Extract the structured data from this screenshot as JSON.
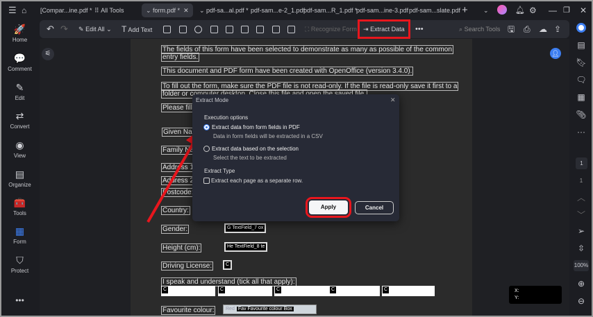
{
  "tabs": {
    "compare": "[Compar...ine.pdf *",
    "all_tools": "All Tools",
    "form": "form.pdf *",
    "t1": "pdf-sa...al.pdf *",
    "t2": "pdf-sam...e-2_1.pdf",
    "t3": "pdf-sam...R_1.pdf *",
    "t4": "pdf-sam...ine-3.pdf",
    "t5": "pdf-sam...slate.pdf"
  },
  "toolbar": {
    "edit_all": "Edit All",
    "add_text": "Add Text",
    "recognize_form": "Recognize Form",
    "extract_data": "Extract Data",
    "search_tools": "Search Tools"
  },
  "sidebar": {
    "items": [
      {
        "label": "Home",
        "icon": "🚀"
      },
      {
        "label": "Comment",
        "icon": "💬"
      },
      {
        "label": "Edit",
        "icon": "✎"
      },
      {
        "label": "Convert",
        "icon": "⇄"
      },
      {
        "label": "View",
        "icon": "◉"
      },
      {
        "label": "Organize",
        "icon": "▤"
      },
      {
        "label": "Tools",
        "icon": "🧰"
      },
      {
        "label": "Form",
        "icon": "▦"
      },
      {
        "label": "Protect",
        "icon": "⛉"
      }
    ]
  },
  "pdf": {
    "p1": "The fields of this form have been selected to demonstrate as many as possible of the common",
    "p1b": "entry fields.",
    "p2": "This document and PDF form have been created with OpenOffice (version 3.4.0).",
    "p3": "To fill out the form, make sure the PDF file is not read-only. If the file is read-only save it first to a",
    "p3b": "folder or computer desktop. Close this file and open the saved file.",
    "p4": "Please fill o",
    "given": "Given Nam",
    "family": "Family Na",
    "addr1": "Address 1:",
    "addr2": "Address 2:",
    "postcode": "Postcode:",
    "country": "Country:",
    "gender": "Gender:",
    "height": "Height (cm):",
    "driving": "Driving License:",
    "speak": "I speak and understand (tick all that apply):",
    "colour": "Favourite colour:",
    "gender_field": "G TextField_7 ox",
    "height_field": "He TextField_8 te",
    "check": "C",
    "colour_field": "Fav Favourite colour Box",
    "colour_opt": "Red"
  },
  "dialog": {
    "title": "Extract Mode",
    "section1": "Execution options",
    "opt1": "Extract data from form fields in PDF",
    "opt1_desc": "Data in form fields will be extracted in a CSV",
    "opt2": "Extract data based on the selection",
    "opt2_desc": "Select the text to be extracted",
    "section2": "Extract Type",
    "check1": "Extract each page as a separate row.",
    "apply": "Apply",
    "cancel": "Cancel",
    "opt1_selected": true,
    "check1_checked": false
  },
  "right": {
    "page_current": "1",
    "page_total": "1",
    "zoom": "100%"
  },
  "coords": {
    "x": "X:",
    "y": "Y:"
  },
  "colors": {
    "highlight": "#e8161d",
    "accent": "#3d7ef0"
  }
}
